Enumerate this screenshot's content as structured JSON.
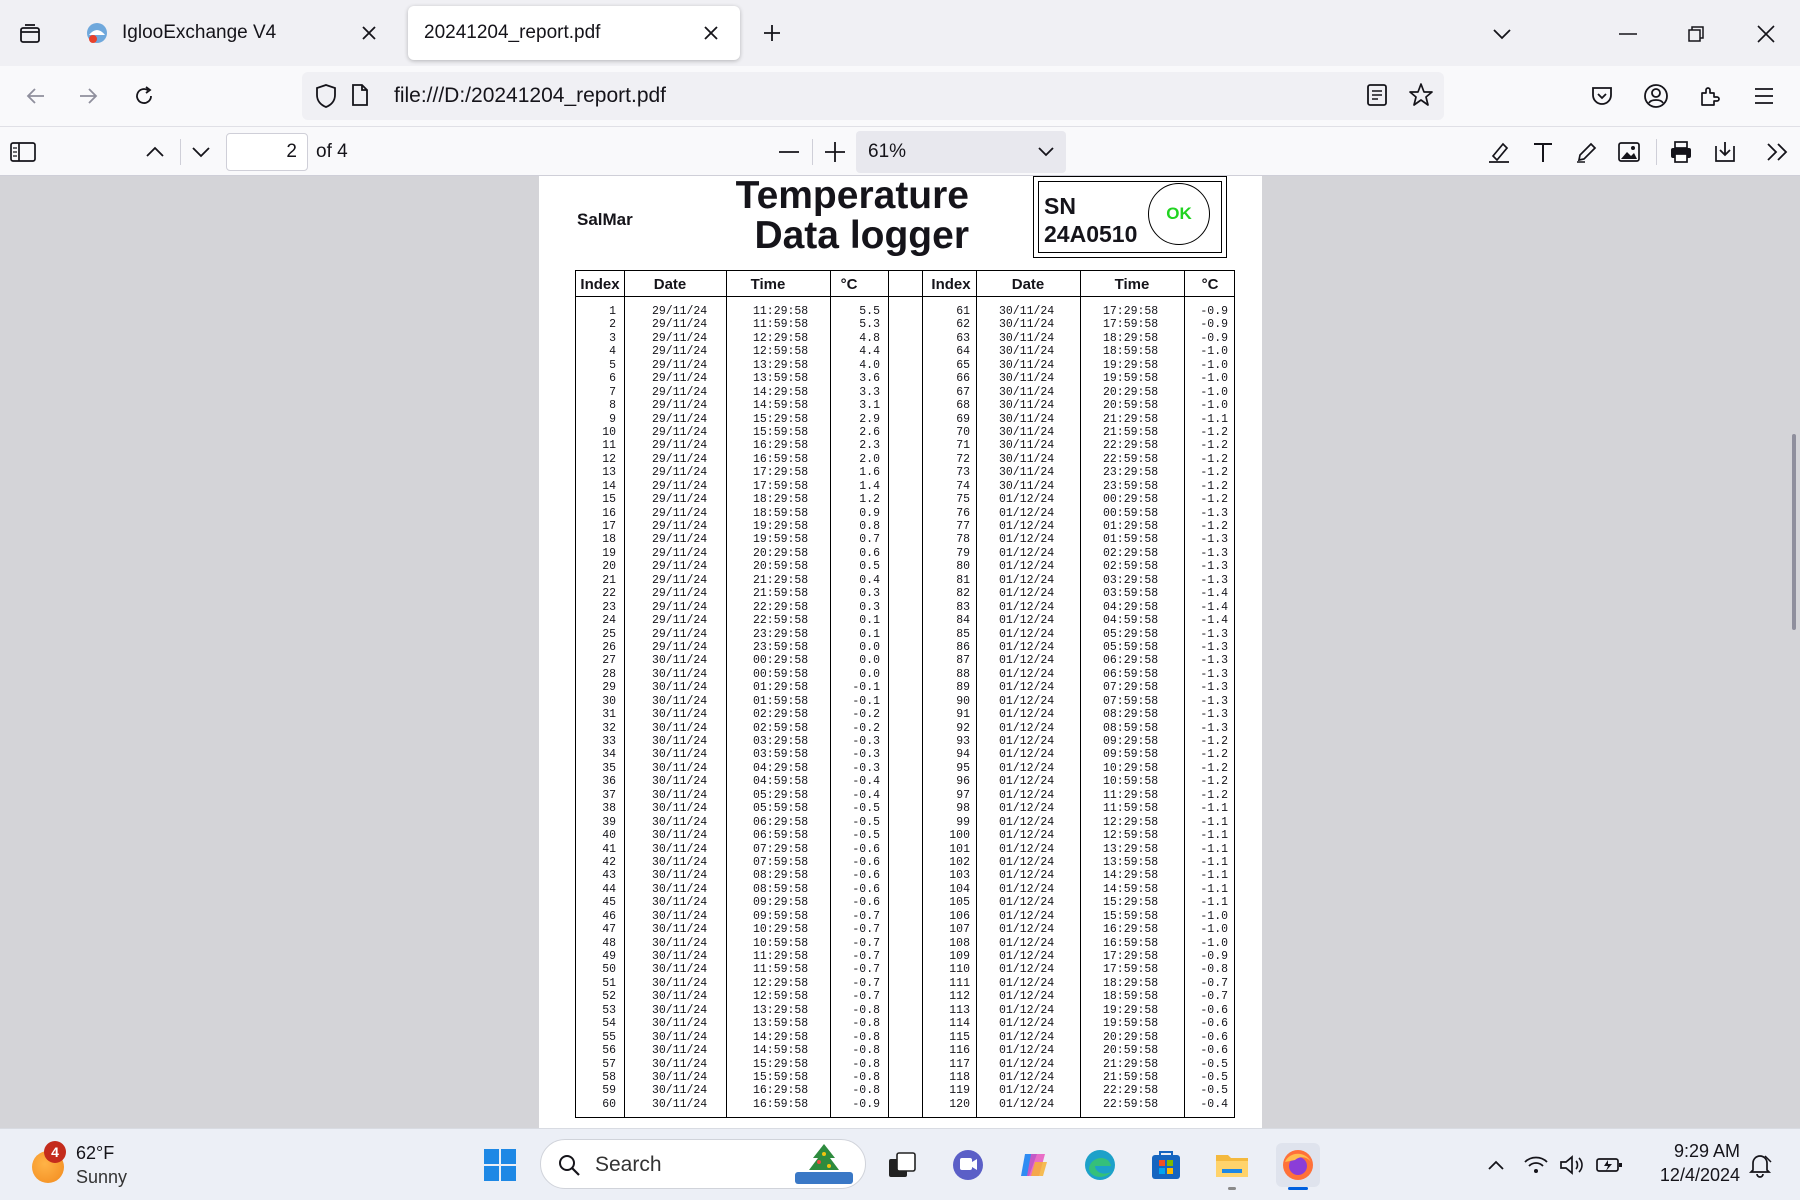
{
  "browser": {
    "tabs": [
      {
        "title": "IglooExchange V4",
        "active": false
      },
      {
        "title": "20241204_report.pdf",
        "active": true
      }
    ],
    "url": "file:///D:/20241204_report.pdf"
  },
  "pdf_toolbar": {
    "page_number": "2",
    "page_total": "of 4",
    "zoom": "61%"
  },
  "document": {
    "brand": "SalMar",
    "title_line1": "Temperature",
    "title_line2": "Data logger",
    "sn_label": "SN",
    "sn_value": "24A0510",
    "status": "OK",
    "status_color": "#21d321",
    "headers": [
      "Index",
      "Date",
      "Time",
      "°C",
      "Index",
      "Date",
      "Time",
      "°C"
    ],
    "left": {
      "index": [
        "1",
        "2",
        "3",
        "4",
        "5",
        "6",
        "7",
        "8",
        "9",
        "10",
        "11",
        "12",
        "13",
        "14",
        "15",
        "16",
        "17",
        "18",
        "19",
        "20",
        "21",
        "22",
        "23",
        "24",
        "25",
        "26",
        "27",
        "28",
        "29",
        "30",
        "31",
        "32",
        "33",
        "34",
        "35",
        "36",
        "37",
        "38",
        "39",
        "40",
        "41",
        "42",
        "43",
        "44",
        "45",
        "46",
        "47",
        "48",
        "49",
        "50",
        "51",
        "52",
        "53",
        "54",
        "55",
        "56",
        "57",
        "58",
        "59",
        "60"
      ],
      "date": [
        "29/11/24",
        "29/11/24",
        "29/11/24",
        "29/11/24",
        "29/11/24",
        "29/11/24",
        "29/11/24",
        "29/11/24",
        "29/11/24",
        "29/11/24",
        "29/11/24",
        "29/11/24",
        "29/11/24",
        "29/11/24",
        "29/11/24",
        "29/11/24",
        "29/11/24",
        "29/11/24",
        "29/11/24",
        "29/11/24",
        "29/11/24",
        "29/11/24",
        "29/11/24",
        "29/11/24",
        "29/11/24",
        "29/11/24",
        "30/11/24",
        "30/11/24",
        "30/11/24",
        "30/11/24",
        "30/11/24",
        "30/11/24",
        "30/11/24",
        "30/11/24",
        "30/11/24",
        "30/11/24",
        "30/11/24",
        "30/11/24",
        "30/11/24",
        "30/11/24",
        "30/11/24",
        "30/11/24",
        "30/11/24",
        "30/11/24",
        "30/11/24",
        "30/11/24",
        "30/11/24",
        "30/11/24",
        "30/11/24",
        "30/11/24",
        "30/11/24",
        "30/11/24",
        "30/11/24",
        "30/11/24",
        "30/11/24",
        "30/11/24",
        "30/11/24",
        "30/11/24",
        "30/11/24",
        "30/11/24"
      ],
      "time": [
        "11:29:58",
        "11:59:58",
        "12:29:58",
        "12:59:58",
        "13:29:58",
        "13:59:58",
        "14:29:58",
        "14:59:58",
        "15:29:58",
        "15:59:58",
        "16:29:58",
        "16:59:58",
        "17:29:58",
        "17:59:58",
        "18:29:58",
        "18:59:58",
        "19:29:58",
        "19:59:58",
        "20:29:58",
        "20:59:58",
        "21:29:58",
        "21:59:58",
        "22:29:58",
        "22:59:58",
        "23:29:58",
        "23:59:58",
        "00:29:58",
        "00:59:58",
        "01:29:58",
        "01:59:58",
        "02:29:58",
        "02:59:58",
        "03:29:58",
        "03:59:58",
        "04:29:58",
        "04:59:58",
        "05:29:58",
        "05:59:58",
        "06:29:58",
        "06:59:58",
        "07:29:58",
        "07:59:58",
        "08:29:58",
        "08:59:58",
        "09:29:58",
        "09:59:58",
        "10:29:58",
        "10:59:58",
        "11:29:58",
        "11:59:58",
        "12:29:58",
        "12:59:58",
        "13:29:58",
        "13:59:58",
        "14:29:58",
        "14:59:58",
        "15:29:58",
        "15:59:58",
        "16:29:58",
        "16:59:58"
      ],
      "temp": [
        "5.5",
        "5.3",
        "4.8",
        "4.4",
        "4.0",
        "3.6",
        "3.3",
        "3.1",
        "2.9",
        "2.6",
        "2.3",
        "2.0",
        "1.6",
        "1.4",
        "1.2",
        "0.9",
        "0.8",
        "0.7",
        "0.6",
        "0.5",
        "0.4",
        "0.3",
        "0.3",
        "0.1",
        "0.1",
        "0.0",
        "0.0",
        "0.0",
        "-0.1",
        "-0.1",
        "-0.2",
        "-0.2",
        "-0.3",
        "-0.3",
        "-0.3",
        "-0.4",
        "-0.4",
        "-0.5",
        "-0.5",
        "-0.5",
        "-0.6",
        "-0.6",
        "-0.6",
        "-0.6",
        "-0.6",
        "-0.7",
        "-0.7",
        "-0.7",
        "-0.7",
        "-0.7",
        "-0.7",
        "-0.7",
        "-0.8",
        "-0.8",
        "-0.8",
        "-0.8",
        "-0.8",
        "-0.8",
        "-0.8",
        "-0.9"
      ]
    },
    "right": {
      "index": [
        "61",
        "62",
        "63",
        "64",
        "65",
        "66",
        "67",
        "68",
        "69",
        "70",
        "71",
        "72",
        "73",
        "74",
        "75",
        "76",
        "77",
        "78",
        "79",
        "80",
        "81",
        "82",
        "83",
        "84",
        "85",
        "86",
        "87",
        "88",
        "89",
        "90",
        "91",
        "92",
        "93",
        "94",
        "95",
        "96",
        "97",
        "98",
        "99",
        "100",
        "101",
        "102",
        "103",
        "104",
        "105",
        "106",
        "107",
        "108",
        "109",
        "110",
        "111",
        "112",
        "113",
        "114",
        "115",
        "116",
        "117",
        "118",
        "119",
        "120"
      ],
      "date": [
        "30/11/24",
        "30/11/24",
        "30/11/24",
        "30/11/24",
        "30/11/24",
        "30/11/24",
        "30/11/24",
        "30/11/24",
        "30/11/24",
        "30/11/24",
        "30/11/24",
        "30/11/24",
        "30/11/24",
        "30/11/24",
        "01/12/24",
        "01/12/24",
        "01/12/24",
        "01/12/24",
        "01/12/24",
        "01/12/24",
        "01/12/24",
        "01/12/24",
        "01/12/24",
        "01/12/24",
        "01/12/24",
        "01/12/24",
        "01/12/24",
        "01/12/24",
        "01/12/24",
        "01/12/24",
        "01/12/24",
        "01/12/24",
        "01/12/24",
        "01/12/24",
        "01/12/24",
        "01/12/24",
        "01/12/24",
        "01/12/24",
        "01/12/24",
        "01/12/24",
        "01/12/24",
        "01/12/24",
        "01/12/24",
        "01/12/24",
        "01/12/24",
        "01/12/24",
        "01/12/24",
        "01/12/24",
        "01/12/24",
        "01/12/24",
        "01/12/24",
        "01/12/24",
        "01/12/24",
        "01/12/24",
        "01/12/24",
        "01/12/24",
        "01/12/24",
        "01/12/24",
        "01/12/24",
        "01/12/24"
      ],
      "time": [
        "17:29:58",
        "17:59:58",
        "18:29:58",
        "18:59:58",
        "19:29:58",
        "19:59:58",
        "20:29:58",
        "20:59:58",
        "21:29:58",
        "21:59:58",
        "22:29:58",
        "22:59:58",
        "23:29:58",
        "23:59:58",
        "00:29:58",
        "00:59:58",
        "01:29:58",
        "01:59:58",
        "02:29:58",
        "02:59:58",
        "03:29:58",
        "03:59:58",
        "04:29:58",
        "04:59:58",
        "05:29:58",
        "05:59:58",
        "06:29:58",
        "06:59:58",
        "07:29:58",
        "07:59:58",
        "08:29:58",
        "08:59:58",
        "09:29:58",
        "09:59:58",
        "10:29:58",
        "10:59:58",
        "11:29:58",
        "11:59:58",
        "12:29:58",
        "12:59:58",
        "13:29:58",
        "13:59:58",
        "14:29:58",
        "14:59:58",
        "15:29:58",
        "15:59:58",
        "16:29:58",
        "16:59:58",
        "17:29:58",
        "17:59:58",
        "18:29:58",
        "18:59:58",
        "19:29:58",
        "19:59:58",
        "20:29:58",
        "20:59:58",
        "21:29:58",
        "21:59:58",
        "22:29:58",
        "22:59:58"
      ],
      "temp": [
        "-0.9",
        "-0.9",
        "-0.9",
        "-1.0",
        "-1.0",
        "-1.0",
        "-1.0",
        "-1.0",
        "-1.1",
        "-1.2",
        "-1.2",
        "-1.2",
        "-1.2",
        "-1.2",
        "-1.2",
        "-1.3",
        "-1.2",
        "-1.3",
        "-1.3",
        "-1.3",
        "-1.3",
        "-1.4",
        "-1.4",
        "-1.4",
        "-1.3",
        "-1.3",
        "-1.3",
        "-1.3",
        "-1.3",
        "-1.3",
        "-1.3",
        "-1.3",
        "-1.2",
        "-1.2",
        "-1.2",
        "-1.2",
        "-1.2",
        "-1.1",
        "-1.1",
        "-1.1",
        "-1.1",
        "-1.1",
        "-1.1",
        "-1.1",
        "-1.1",
        "-1.0",
        "-1.0",
        "-1.0",
        "-0.9",
        "-0.8",
        "-0.7",
        "-0.7",
        "-0.6",
        "-0.6",
        "-0.6",
        "-0.6",
        "-0.5",
        "-0.5",
        "-0.5",
        "-0.4"
      ]
    }
  },
  "taskbar": {
    "weather_temp": "62°F",
    "weather_cond": "Sunny",
    "weather_badge": "4",
    "search_label": "Search",
    "time": "9:29 AM",
    "date": "12/4/2024",
    "pinned": [
      "start-icon",
      "search-icon",
      "task-view-icon",
      "teams-icon",
      "copilot-icon",
      "edge-icon",
      "store-icon",
      "file-explorer-icon",
      "firefox-icon"
    ]
  },
  "colors": {
    "accent": "#0060df",
    "ok_green": "#21d321",
    "firefox_active": "#0060df"
  }
}
